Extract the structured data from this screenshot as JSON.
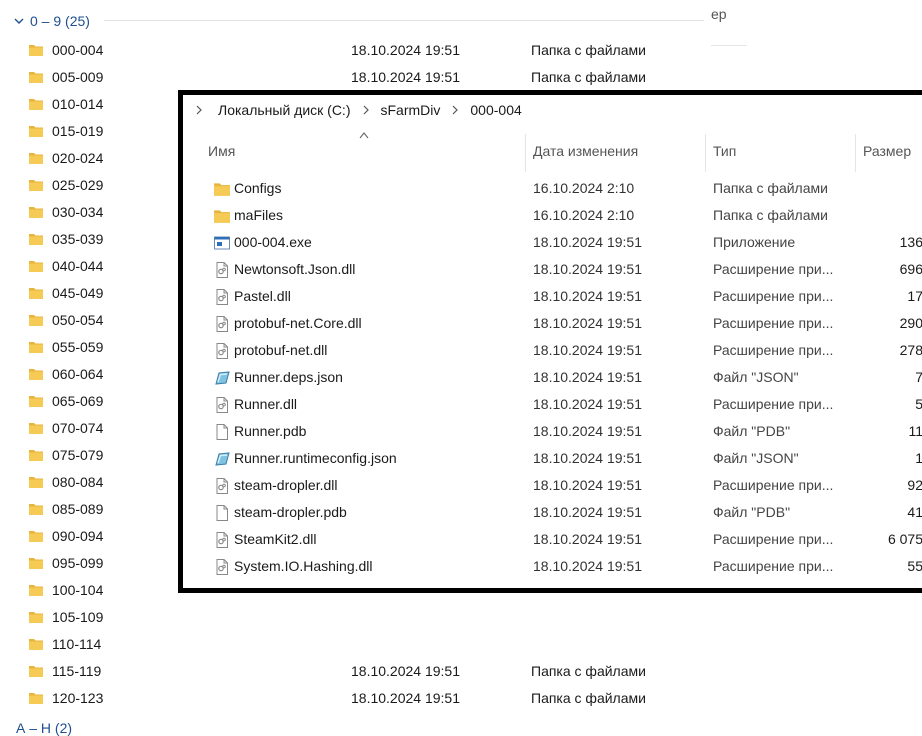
{
  "group_header": {
    "label": "0 – 9 (25)"
  },
  "bg_column_label": "ер",
  "background_rows": [
    {
      "name": "000-004",
      "date": "18.10.2024 19:51",
      "type": "Папка с файлами"
    },
    {
      "name": "005-009",
      "date": "18.10.2024 19:51",
      "type": "Папка с файлами"
    },
    {
      "name": "010-014",
      "date": "",
      "type": ""
    },
    {
      "name": "015-019",
      "date": "",
      "type": ""
    },
    {
      "name": "020-024",
      "date": "",
      "type": ""
    },
    {
      "name": "025-029",
      "date": "",
      "type": ""
    },
    {
      "name": "030-034",
      "date": "",
      "type": ""
    },
    {
      "name": "035-039",
      "date": "",
      "type": ""
    },
    {
      "name": "040-044",
      "date": "",
      "type": ""
    },
    {
      "name": "045-049",
      "date": "",
      "type": ""
    },
    {
      "name": "050-054",
      "date": "",
      "type": ""
    },
    {
      "name": "055-059",
      "date": "",
      "type": ""
    },
    {
      "name": "060-064",
      "date": "",
      "type": ""
    },
    {
      "name": "065-069",
      "date": "",
      "type": ""
    },
    {
      "name": "070-074",
      "date": "",
      "type": ""
    },
    {
      "name": "075-079",
      "date": "",
      "type": ""
    },
    {
      "name": "080-084",
      "date": "",
      "type": ""
    },
    {
      "name": "085-089",
      "date": "",
      "type": ""
    },
    {
      "name": "090-094",
      "date": "",
      "type": ""
    },
    {
      "name": "095-099",
      "date": "",
      "type": ""
    },
    {
      "name": "100-104",
      "date": "",
      "type": ""
    },
    {
      "name": "105-109",
      "date": "",
      "type": ""
    },
    {
      "name": "110-114",
      "date": "",
      "type": ""
    },
    {
      "name": "115-119",
      "date": "18.10.2024 19:51",
      "type": "Папка с файлами"
    },
    {
      "name": "120-123",
      "date": "18.10.2024 19:51",
      "type": "Папка с файлами"
    }
  ],
  "overlay": {
    "breadcrumb": [
      "Локальный диск (C:)",
      "sFarmDiv",
      "000-004"
    ],
    "columns": {
      "name": "Имя",
      "date": "Дата изменения",
      "type": "Тип",
      "size": "Размер"
    },
    "files": [
      {
        "name": "Configs",
        "date": "16.10.2024 2:10",
        "type": "Папка с файлами",
        "size": "",
        "icon": "folder-icon"
      },
      {
        "name": "maFiles",
        "date": "16.10.2024 2:10",
        "type": "Папка с файлами",
        "size": "",
        "icon": "folder-icon"
      },
      {
        "name": "000-004.exe",
        "date": "18.10.2024 19:51",
        "type": "Приложение",
        "size": "136",
        "icon": "exe-icon"
      },
      {
        "name": "Newtonsoft.Json.dll",
        "date": "18.10.2024 19:51",
        "type": "Расширение при...",
        "size": "696",
        "icon": "dll-icon"
      },
      {
        "name": "Pastel.dll",
        "date": "18.10.2024 19:51",
        "type": "Расширение при...",
        "size": "17",
        "icon": "dll-icon"
      },
      {
        "name": "protobuf-net.Core.dll",
        "date": "18.10.2024 19:51",
        "type": "Расширение при...",
        "size": "290",
        "icon": "dll-icon"
      },
      {
        "name": "protobuf-net.dll",
        "date": "18.10.2024 19:51",
        "type": "Расширение при...",
        "size": "278",
        "icon": "dll-icon"
      },
      {
        "name": "Runner.deps.json",
        "date": "18.10.2024 19:51",
        "type": "Файл \"JSON\"",
        "size": "7",
        "icon": "json-icon"
      },
      {
        "name": "Runner.dll",
        "date": "18.10.2024 19:51",
        "type": "Расширение при...",
        "size": "5",
        "icon": "dll-icon"
      },
      {
        "name": "Runner.pdb",
        "date": "18.10.2024 19:51",
        "type": "Файл \"PDB\"",
        "size": "11",
        "icon": "pdb-icon"
      },
      {
        "name": "Runner.runtimeconfig.json",
        "date": "18.10.2024 19:51",
        "type": "Файл \"JSON\"",
        "size": "1",
        "icon": "json-icon"
      },
      {
        "name": "steam-dropler.dll",
        "date": "18.10.2024 19:51",
        "type": "Расширение при...",
        "size": "92",
        "icon": "dll-icon"
      },
      {
        "name": "steam-dropler.pdb",
        "date": "18.10.2024 19:51",
        "type": "Файл \"PDB\"",
        "size": "41",
        "icon": "pdb-icon"
      },
      {
        "name": "SteamKit2.dll",
        "date": "18.10.2024 19:51",
        "type": "Расширение при...",
        "size": "6 075",
        "icon": "dll-icon"
      },
      {
        "name": "System.IO.Hashing.dll",
        "date": "18.10.2024 19:51",
        "type": "Расширение при...",
        "size": "55",
        "icon": "dll-icon"
      }
    ]
  },
  "bottom_group": {
    "label": "А – Н (2)"
  },
  "colors": {
    "accent": "#1f4f8f",
    "folder": "#f0c04a",
    "overlay_border": "#000000"
  }
}
